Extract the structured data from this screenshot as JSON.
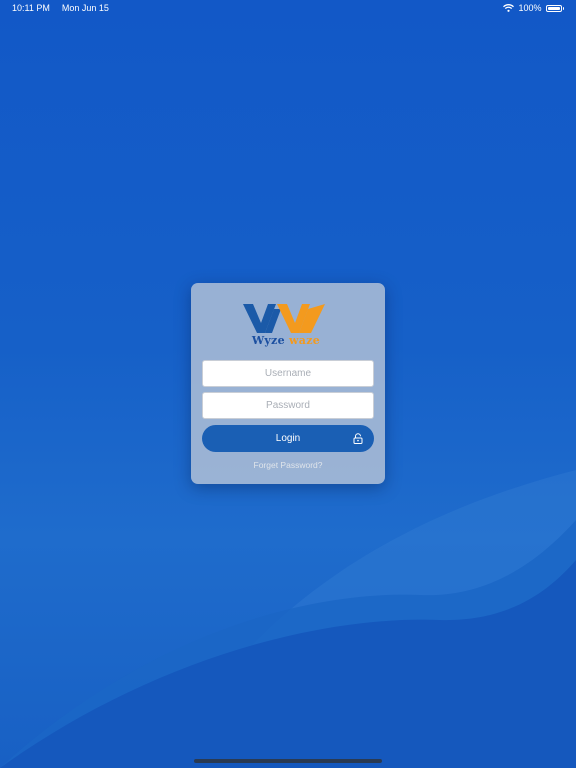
{
  "status_bar": {
    "time": "10:11 PM",
    "date": "Mon Jun 15",
    "battery": "100%",
    "wifi_icon": "wifi-icon",
    "battery_icon": "battery-icon",
    "battery_level": 1.0
  },
  "logo": {
    "mark": "WW",
    "text_part1": "Wyze",
    "text_part2": "waze",
    "colors": {
      "blue": "#1b4fa0",
      "orange": "#f39a1e"
    }
  },
  "form": {
    "username_placeholder": "Username",
    "username_value": "",
    "password_placeholder": "Password",
    "password_value": "",
    "login_label": "Login",
    "login_icon": "lock-icon",
    "forgot_password": "Forget Password?"
  },
  "colors": {
    "background": "#1660c8",
    "button": "#1a5fb4",
    "card": "#bec8d7"
  }
}
